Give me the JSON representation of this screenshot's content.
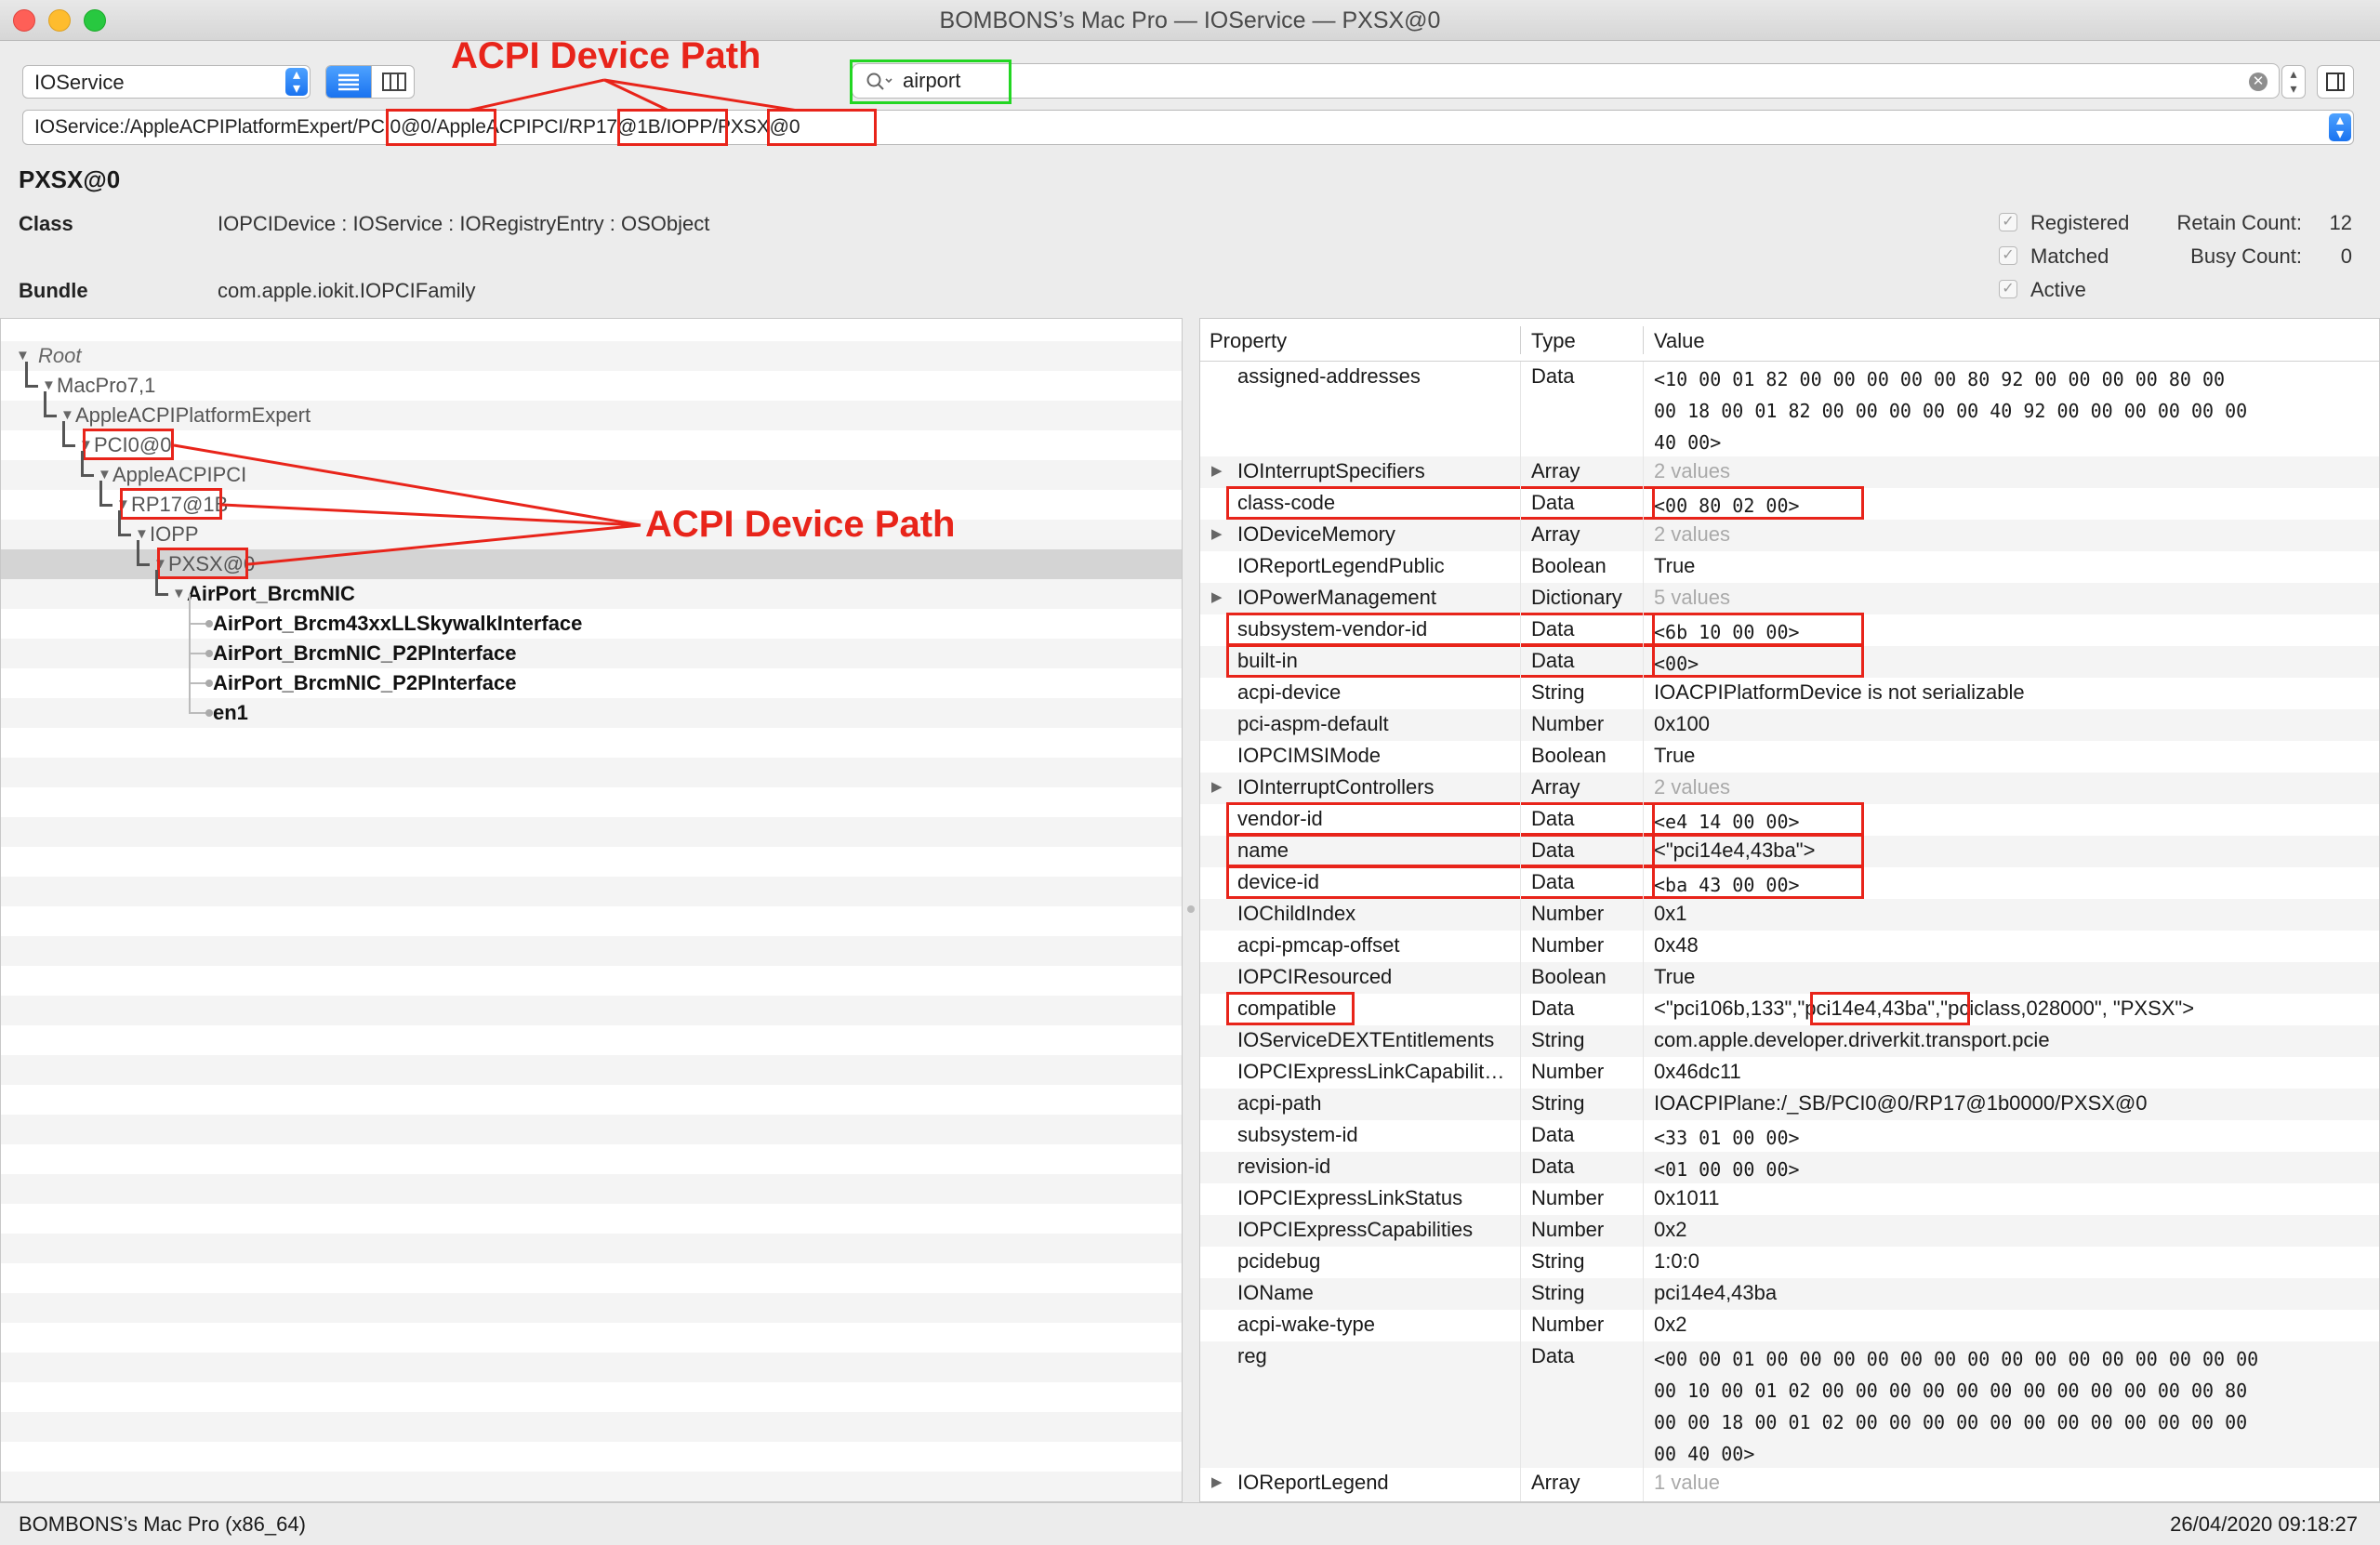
{
  "window": {
    "title": "BOMBONS’s Mac Pro — IOService — PXSX@0"
  },
  "toolbar": {
    "plane_select": "IOService",
    "search_value": "airport",
    "path_value": "IOService:/AppleACPIPlatformExpert/PCI0@0/AppleACPIPCI/RP17@1B/IOPP/PXSX@0"
  },
  "header": {
    "object_name": "PXSX@0",
    "class_label": "Class",
    "class_value": "IOPCIDevice : IOService : IORegistryEntry : OSObject",
    "bundle_label": "Bundle",
    "bundle_value": "com.apple.iokit.IOPCIFamily",
    "flags": [
      "Registered",
      "Matched",
      "Active"
    ],
    "retain_label": "Retain Count:",
    "retain_value": "12",
    "busy_label": "Busy Count:",
    "busy_value": "0"
  },
  "tree": [
    {
      "label": "Root",
      "depth": 0,
      "italic": true,
      "expanded": true
    },
    {
      "label": "MacPro7,1",
      "depth": 1,
      "expanded": true
    },
    {
      "label": "AppleACPIPlatformExpert",
      "depth": 2,
      "expanded": true
    },
    {
      "label": "PCI0@0",
      "depth": 3,
      "expanded": true
    },
    {
      "label": "AppleACPIPCI",
      "depth": 4,
      "expanded": true
    },
    {
      "label": "RP17@1B",
      "depth": 5,
      "expanded": true
    },
    {
      "label": "IOPP",
      "depth": 6,
      "expanded": true
    },
    {
      "label": "PXSX@0",
      "depth": 7,
      "expanded": true,
      "selected": true
    },
    {
      "label": "AirPort_BrcmNIC",
      "depth": 8,
      "expanded": true,
      "bold": true
    },
    {
      "label": "AirPort_Brcm43xxLLSkywalkInterface",
      "depth": 9,
      "bold": true,
      "leaf": true
    },
    {
      "label": "AirPort_BrcmNIC_P2PInterface",
      "depth": 9,
      "bold": true,
      "leaf": true
    },
    {
      "label": "AirPort_BrcmNIC_P2PInterface",
      "depth": 9,
      "bold": true,
      "leaf": true
    },
    {
      "label": "en1",
      "depth": 9,
      "bold": true,
      "leaf": true
    }
  ],
  "properties": {
    "headers": [
      "Property",
      "Type",
      "Value"
    ],
    "rows": [
      {
        "name": "assigned-addresses",
        "type": "Data",
        "value": [
          "<10 00 01 82 00 00 00 00 00 80 92 00 00 00 00 80 00",
          " 00 18 00 01 82 00 00 00 00 00 40 92 00 00 00 00 00 00",
          " 40 00>"
        ],
        "mono": true
      },
      {
        "name": "IOInterruptSpecifiers",
        "type": "Array",
        "value": [
          "2 values"
        ],
        "gray": true,
        "disclosure": true
      },
      {
        "name": "class-code",
        "type": "Data",
        "value": [
          "<00 80 02 00>"
        ],
        "mono": true,
        "boxed": true
      },
      {
        "name": "IODeviceMemory",
        "type": "Array",
        "value": [
          "2 values"
        ],
        "gray": true,
        "disclosure": true
      },
      {
        "name": "IOReportLegendPublic",
        "type": "Boolean",
        "value": [
          "True"
        ]
      },
      {
        "name": "IOPowerManagement",
        "type": "Dictionary",
        "value": [
          "5 values"
        ],
        "gray": true,
        "disclosure": true
      },
      {
        "name": "subsystem-vendor-id",
        "type": "Data",
        "value": [
          "<6b 10 00 00>"
        ],
        "mono": true,
        "boxed": true
      },
      {
        "name": "built-in",
        "type": "Data",
        "value": [
          "<00>"
        ],
        "mono": true,
        "boxed": true
      },
      {
        "name": "acpi-device",
        "type": "String",
        "value": [
          "IOACPIPlatformDevice is not serializable"
        ]
      },
      {
        "name": "pci-aspm-default",
        "type": "Number",
        "value": [
          "0x100"
        ]
      },
      {
        "name": "IOPCIMSIMode",
        "type": "Boolean",
        "value": [
          "True"
        ]
      },
      {
        "name": "IOInterruptControllers",
        "type": "Array",
        "value": [
          "2 values"
        ],
        "gray": true,
        "disclosure": true
      },
      {
        "name": "vendor-id",
        "type": "Data",
        "value": [
          "<e4 14 00 00>"
        ],
        "mono": true,
        "boxed": true
      },
      {
        "name": "name",
        "type": "Data",
        "value": [
          "<\"pci14e4,43ba\">"
        ],
        "boxed": true
      },
      {
        "name": "device-id",
        "type": "Data",
        "value": [
          "<ba 43 00 00>"
        ],
        "mono": true,
        "boxed": true
      },
      {
        "name": "IOChildIndex",
        "type": "Number",
        "value": [
          "0x1"
        ]
      },
      {
        "name": "acpi-pmcap-offset",
        "type": "Number",
        "value": [
          "0x48"
        ]
      },
      {
        "name": "IOPCIResourced",
        "type": "Boolean",
        "value": [
          "True"
        ]
      },
      {
        "name": "compatible",
        "type": "Data",
        "value": [
          "<\"pci106b,133\",\"pci14e4,43ba\",\"pciclass,028000\", \"PXSX\">"
        ],
        "name_boxed": true
      },
      {
        "name": "IOServiceDEXTEntitlements",
        "type": "String",
        "value": [
          "com.apple.developer.driverkit.transport.pcie"
        ]
      },
      {
        "name": "IOPCIExpressLinkCapabilit…",
        "type": "Number",
        "value": [
          "0x46dc11"
        ]
      },
      {
        "name": "acpi-path",
        "type": "String",
        "value": [
          "IOACPIPlane:/_SB/PCI0@0/RP17@1b0000/PXSX@0"
        ]
      },
      {
        "name": "subsystem-id",
        "type": "Data",
        "value": [
          "<33 01 00 00>"
        ],
        "mono": true
      },
      {
        "name": "revision-id",
        "type": "Data",
        "value": [
          "<01 00 00 00>"
        ],
        "mono": true
      },
      {
        "name": "IOPCIExpressLinkStatus",
        "type": "Number",
        "value": [
          "0x1011"
        ]
      },
      {
        "name": "IOPCIExpressCapabilities",
        "type": "Number",
        "value": [
          "0x2"
        ]
      },
      {
        "name": "pcidebug",
        "type": "String",
        "value": [
          "1:0:0"
        ]
      },
      {
        "name": "IOName",
        "type": "String",
        "value": [
          "pci14e4,43ba"
        ]
      },
      {
        "name": "acpi-wake-type",
        "type": "Number",
        "value": [
          "0x2"
        ]
      },
      {
        "name": "reg",
        "type": "Data",
        "value": [
          "<00 00 01 00 00 00 00 00 00 00 00 00 00 00 00 00 00 00",
          " 00 10 00 01 02 00 00 00 00 00 00 00 00 00 00 00 00 80",
          " 00 00 18 00 01 02 00 00 00 00 00 00 00 00 00 00 00 00",
          " 00 40 00>"
        ],
        "mono": true
      },
      {
        "name": "IOReportLegend",
        "type": "Array",
        "value": [
          "1 value"
        ],
        "gray": true,
        "disclosure": true
      }
    ]
  },
  "annotations": {
    "top_label": "ACPI Device Path",
    "tree_label": "ACPI Device Path",
    "color": "#e8241a",
    "search_highlight_color": "#22d622"
  },
  "status": {
    "machine": "BOMBONS’s Mac Pro (x86_64)",
    "timestamp": "26/04/2020 09:18:27"
  },
  "colors": {
    "accent": "#1a73f0",
    "selection": "#d4d4d4"
  }
}
